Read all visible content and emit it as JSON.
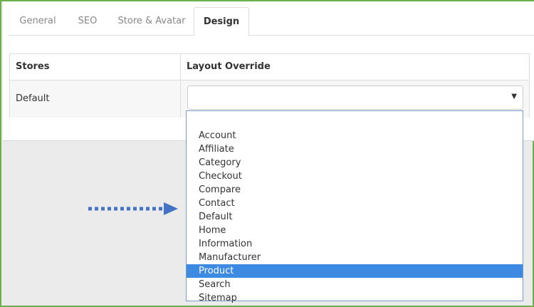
{
  "tabs": [
    {
      "label": "General"
    },
    {
      "label": "SEO"
    },
    {
      "label": "Store & Avatar"
    },
    {
      "label": "Design",
      "active": true
    }
  ],
  "table": {
    "headers": {
      "stores": "Stores",
      "layout": "Layout Override"
    },
    "rows": [
      {
        "store": "Default",
        "layout_value": ""
      }
    ]
  },
  "dropdown": {
    "options": [
      "",
      "Account",
      "Affiliate",
      "Category",
      "Checkout",
      "Compare",
      "Contact",
      "Default",
      "Home",
      "Information",
      "Manufacturer",
      "Product",
      "Search",
      "Sitemap"
    ],
    "highlighted": "Product"
  },
  "colors": {
    "frame_border": "#6ab04c",
    "highlight": "#3d8ae2",
    "arrow": "#4472c4"
  },
  "icons": {
    "caret": "caret-down-icon",
    "pointer": "dotted-arrow-icon"
  }
}
